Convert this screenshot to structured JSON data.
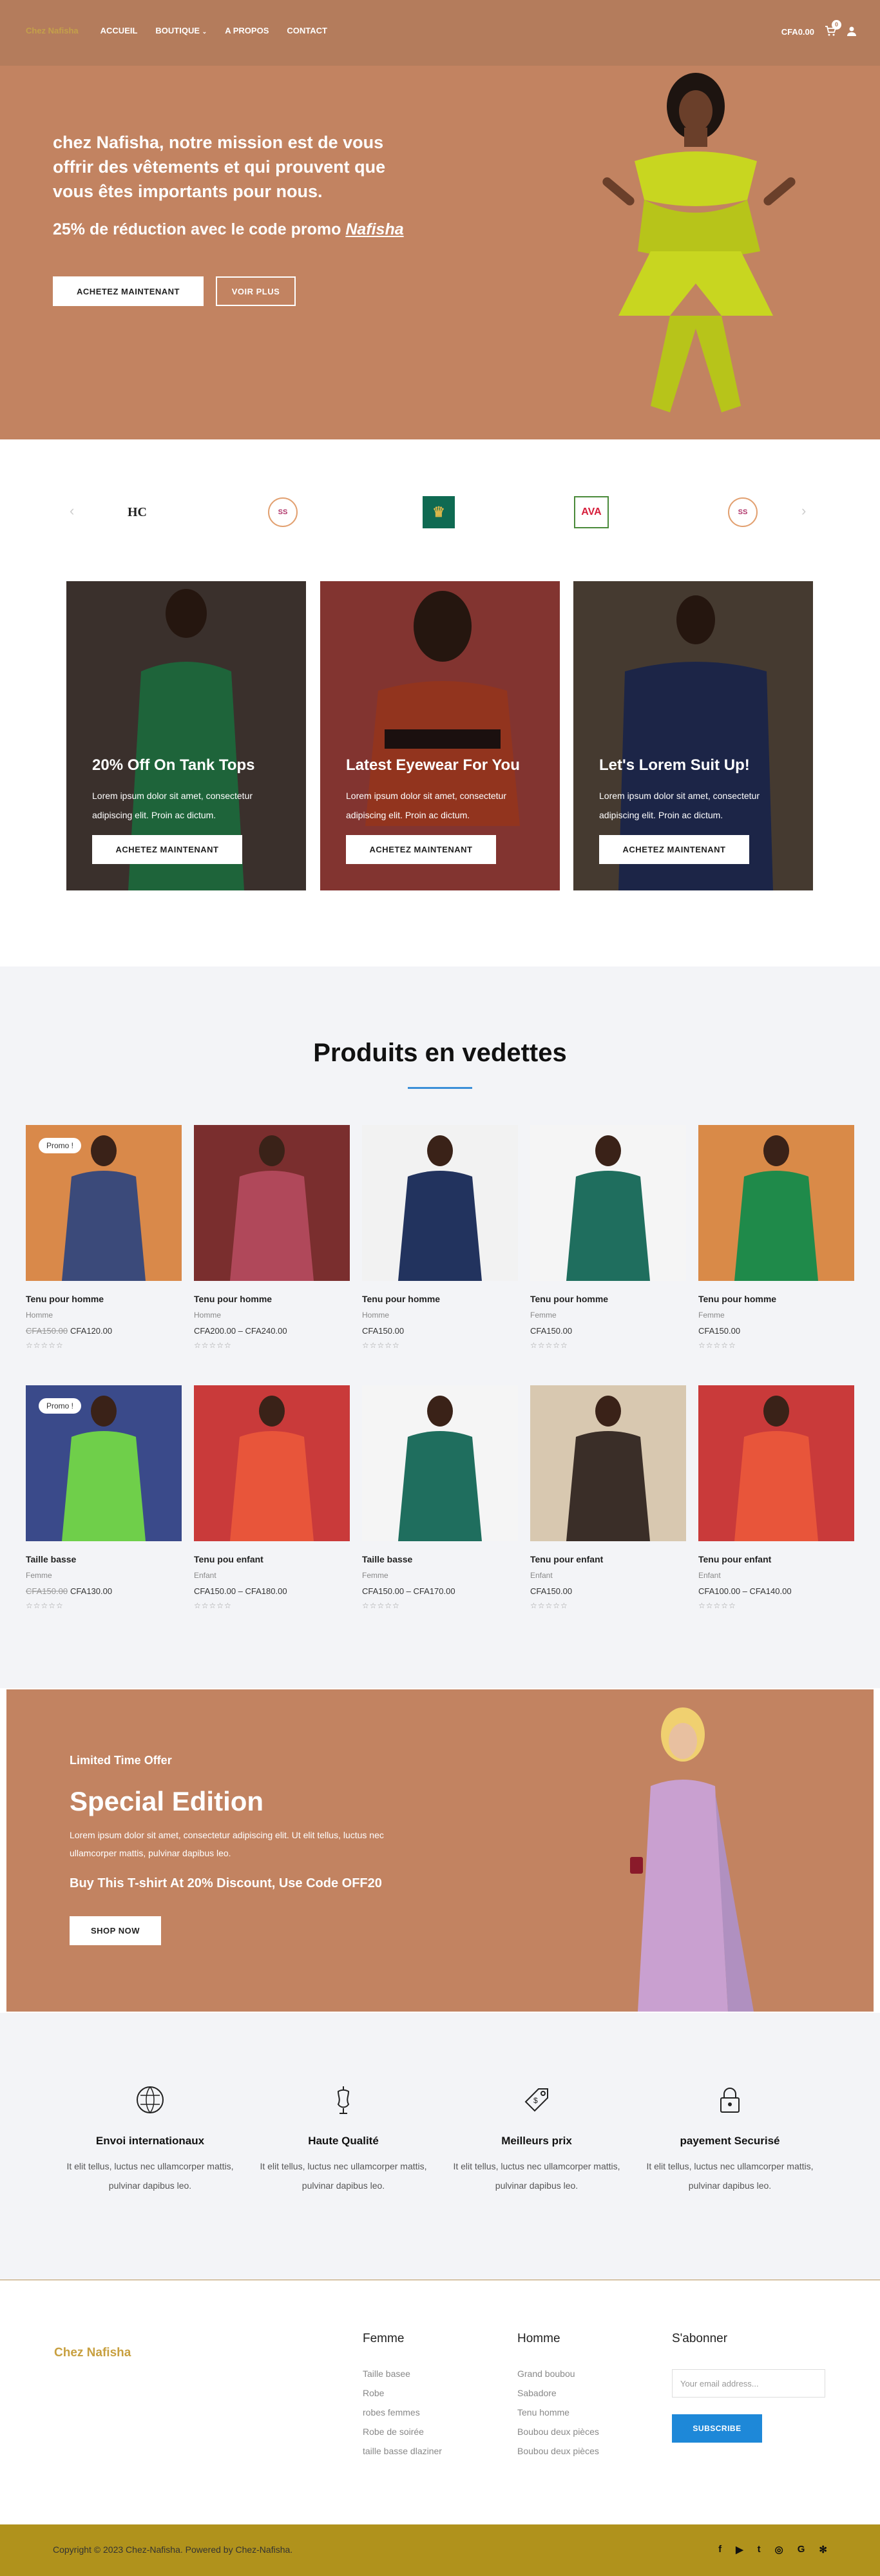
{
  "header": {
    "logo": "Chez Nafisha",
    "nav": [
      "ACCUEIL",
      "BOUTIQUE",
      "A PROPOS",
      "CONTACT"
    ],
    "cart_total": "CFA0.00",
    "cart_count": "0"
  },
  "hero": {
    "headline": "chez Nafisha, notre mission est de vous offrir des vêtements et qui prouvent que vous êtes importants pour nous.",
    "promo_prefix": "25% de réduction avec le code promo ",
    "promo_code": "Nafisha",
    "btn_primary": "ACHETEZ MAINTENANT",
    "btn_secondary": "VOIR PLUS"
  },
  "brands": [
    "HC",
    "SS",
    "♛",
    "AVA",
    "SS"
  ],
  "promo_cards": [
    {
      "title": "20% Off On Tank Tops",
      "text": "Lorem ipsum dolor sit amet, consectetur adipiscing elit. Proin ac dictum.",
      "button": "ACHETEZ MAINTENANT",
      "color": "#2e9a5a"
    },
    {
      "title": "Latest Eyewear For You",
      "text": "Lorem ipsum dolor sit amet, consectetur adipiscing elit. Proin ac dictum.",
      "button": "ACHETEZ MAINTENANT",
      "color": "#e0512f"
    },
    {
      "title": "Let's Lorem Suit Up!",
      "text": "Lorem ipsum dolor sit amet, consectetur adipiscing elit. Proin ac dictum.",
      "button": "ACHETEZ MAINTENANT",
      "color": "#2b3a6e"
    }
  ],
  "featured": {
    "title": "Produits en vedettes",
    "products": [
      {
        "name": "Tenu pour homme",
        "category": "Homme",
        "old_price": "CFA150.00",
        "price": "CFA120.00",
        "badge": "Promo !",
        "color": "#3b4a7a",
        "bg": "#d9894a"
      },
      {
        "name": "Tenu pour homme",
        "category": "Homme",
        "old_price": "",
        "price": "CFA200.00 – CFA240.00",
        "badge": "",
        "color": "#b0485a",
        "bg": "#7a2e2e"
      },
      {
        "name": "Tenu pour homme",
        "category": "Homme",
        "old_price": "",
        "price": "CFA150.00",
        "badge": "",
        "color": "#22335e",
        "bg": "#f2f2f2"
      },
      {
        "name": "Tenu pour homme",
        "category": "Femme",
        "old_price": "",
        "price": "CFA150.00",
        "badge": "",
        "color": "#1f6e5e",
        "bg": "#f5f5f5"
      },
      {
        "name": "Tenu pour homme",
        "category": "Femme",
        "old_price": "",
        "price": "CFA150.00",
        "badge": "",
        "color": "#1f8a4a",
        "bg": "#d98a48"
      },
      {
        "name": "Taille basse",
        "category": "Femme",
        "old_price": "CFA150.00",
        "price": "CFA130.00",
        "badge": "Promo !",
        "color": "#6fcf4a",
        "bg": "#3a4a8a"
      },
      {
        "name": "Tenu pou enfant",
        "category": "Enfant",
        "old_price": "",
        "price": "CFA150.00 – CFA180.00",
        "badge": "",
        "color": "#e8553a",
        "bg": "#c93a3a"
      },
      {
        "name": "Taille basse",
        "category": "Femme",
        "old_price": "",
        "price": "CFA150.00 – CFA170.00",
        "badge": "",
        "color": "#1f6e5e",
        "bg": "#f5f5f5"
      },
      {
        "name": "Tenu pour enfant",
        "category": "Enfant",
        "old_price": "",
        "price": "CFA150.00",
        "badge": "",
        "color": "#3a2e28",
        "bg": "#d8c8b0"
      },
      {
        "name": "Tenu pour enfant",
        "category": "Enfant",
        "old_price": "",
        "price": "CFA100.00 – CFA140.00",
        "badge": "",
        "color": "#e8553a",
        "bg": "#c93a3a"
      }
    ],
    "stars": "☆☆☆☆☆"
  },
  "special": {
    "label": "Limited Time Offer",
    "title": "Special Edition",
    "text": "Lorem ipsum dolor sit amet, consectetur adipiscing elit. Ut elit tellus, luctus nec ullamcorper mattis, pulvinar dapibus leo.",
    "discount": "Buy This T-shirt At 20% Discount, Use Code OFF20",
    "button": "SHOP NOW"
  },
  "features": [
    {
      "title": "Envoi internationaux",
      "text": "It elit tellus, luctus nec ullamcorper mattis, pulvinar dapibus leo.",
      "icon": "globe-icon"
    },
    {
      "title": "Haute Qualité",
      "text": "It elit tellus, luctus nec ullamcorper mattis, pulvinar dapibus leo.",
      "icon": "mannequin-icon"
    },
    {
      "title": "Meilleurs prix",
      "text": "It elit tellus, luctus nec ullamcorper mattis, pulvinar dapibus leo.",
      "icon": "price-tag-icon"
    },
    {
      "title": "payement Securisé",
      "text": "It elit tellus, luctus nec ullamcorper mattis, pulvinar dapibus leo.",
      "icon": "lock-icon"
    }
  ],
  "footer": {
    "logo": "Chez Nafisha",
    "col1_title": "Femme",
    "col1": [
      "Taille basee",
      "Robe",
      "robes femmes",
      "Robe de soirée",
      "taille basse dlaziner"
    ],
    "col2_title": "Homme",
    "col2": [
      "Grand boubou",
      "Sabadore",
      "Tenu homme",
      "Boubou deux pièces",
      "Boubou deux pièces"
    ],
    "col3_title": "S'abonner",
    "email_placeholder": "Your email address...",
    "subscribe": "SUBSCRIBE",
    "copyright": "Copyright © 2023 Chez-Nafisha. Powered by Chez-Nafisha.",
    "social": [
      "f",
      "▶",
      "t",
      "◎",
      "G",
      "✻"
    ]
  },
  "colors": {
    "accent": "#c28361",
    "header": "#b47c5c",
    "footer_bar": "#b0921c",
    "button_blue": "#1e88d8"
  }
}
